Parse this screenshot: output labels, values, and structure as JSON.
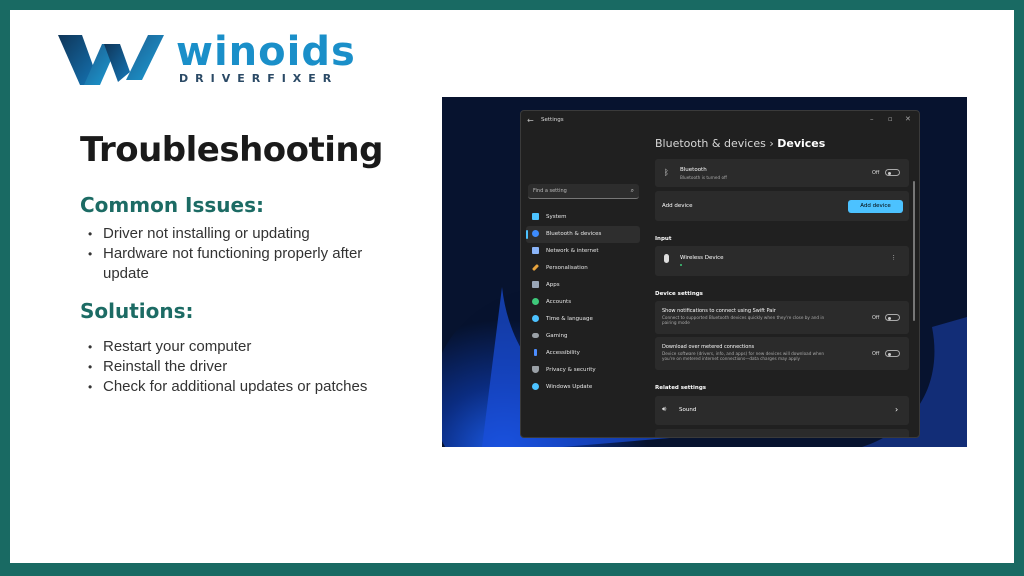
{
  "logo": {
    "word": "winoids",
    "sub": "DRIVERFIXER"
  },
  "slide": {
    "title": "Troubleshooting",
    "issues_heading": "Common Issues:",
    "issues": [
      "Driver not installing or updating",
      "Hardware not functioning properly after update"
    ],
    "solutions_heading": "Solutions:",
    "solutions": [
      "Restart your computer",
      "Reinstall the driver",
      "Check for additional updates or patches"
    ]
  },
  "settings": {
    "window_title": "Settings",
    "search_placeholder": "Find a setting",
    "nav": [
      {
        "label": "System",
        "icon": "monitor-icon",
        "color": "#4cc2ff"
      },
      {
        "label": "Bluetooth & devices",
        "icon": "bluetooth-icon",
        "color": "#3d8bfd"
      },
      {
        "label": "Network & internet",
        "icon": "wifi-icon",
        "color": "#8ab4f8"
      },
      {
        "label": "Personalisation",
        "icon": "brush-icon",
        "color": "#e8a33d"
      },
      {
        "label": "Apps",
        "icon": "apps-icon",
        "color": "#9aa7b8"
      },
      {
        "label": "Accounts",
        "icon": "person-icon",
        "color": "#3ec97a"
      },
      {
        "label": "Time & language",
        "icon": "globe-icon",
        "color": "#4cc2ff"
      },
      {
        "label": "Gaming",
        "icon": "gamepad-icon",
        "color": "#9aa0a6"
      },
      {
        "label": "Accessibility",
        "icon": "accessibility-icon",
        "color": "#4c8dff"
      },
      {
        "label": "Privacy & security",
        "icon": "shield-icon",
        "color": "#9aa0a6"
      },
      {
        "label": "Windows Update",
        "icon": "update-icon",
        "color": "#4cc2ff"
      }
    ],
    "crumb_parent": "Bluetooth & devices",
    "crumb_sep": "›",
    "crumb_current": "Devices",
    "bluetooth": {
      "label": "Bluetooth",
      "sub": "Bluetooth is turned off",
      "state": "Off"
    },
    "add_device": {
      "label": "Add device",
      "button": "Add device"
    },
    "input_heading": "Input",
    "wireless": {
      "label": "Wireless Device",
      "more": "⋮"
    },
    "device_settings_heading": "Device settings",
    "swift_pair": {
      "label": "Show notifications to connect using Swift Pair",
      "sub": "Connect to supported Bluetooth devices quickly when they're close by and in pairing mode",
      "state": "Off"
    },
    "metered": {
      "label": "Download over metered connections",
      "sub": "Device software (drivers, info, and apps) for new devices will download when you're on metered internet connections—data charges may apply",
      "state": "Off"
    },
    "related_heading": "Related settings",
    "sound": {
      "label": "Sound",
      "chevron": "›"
    }
  },
  "colors": {
    "teal": "#196a63",
    "accent": "#4cc2ff",
    "logo_blue": "#1a8fc9"
  }
}
